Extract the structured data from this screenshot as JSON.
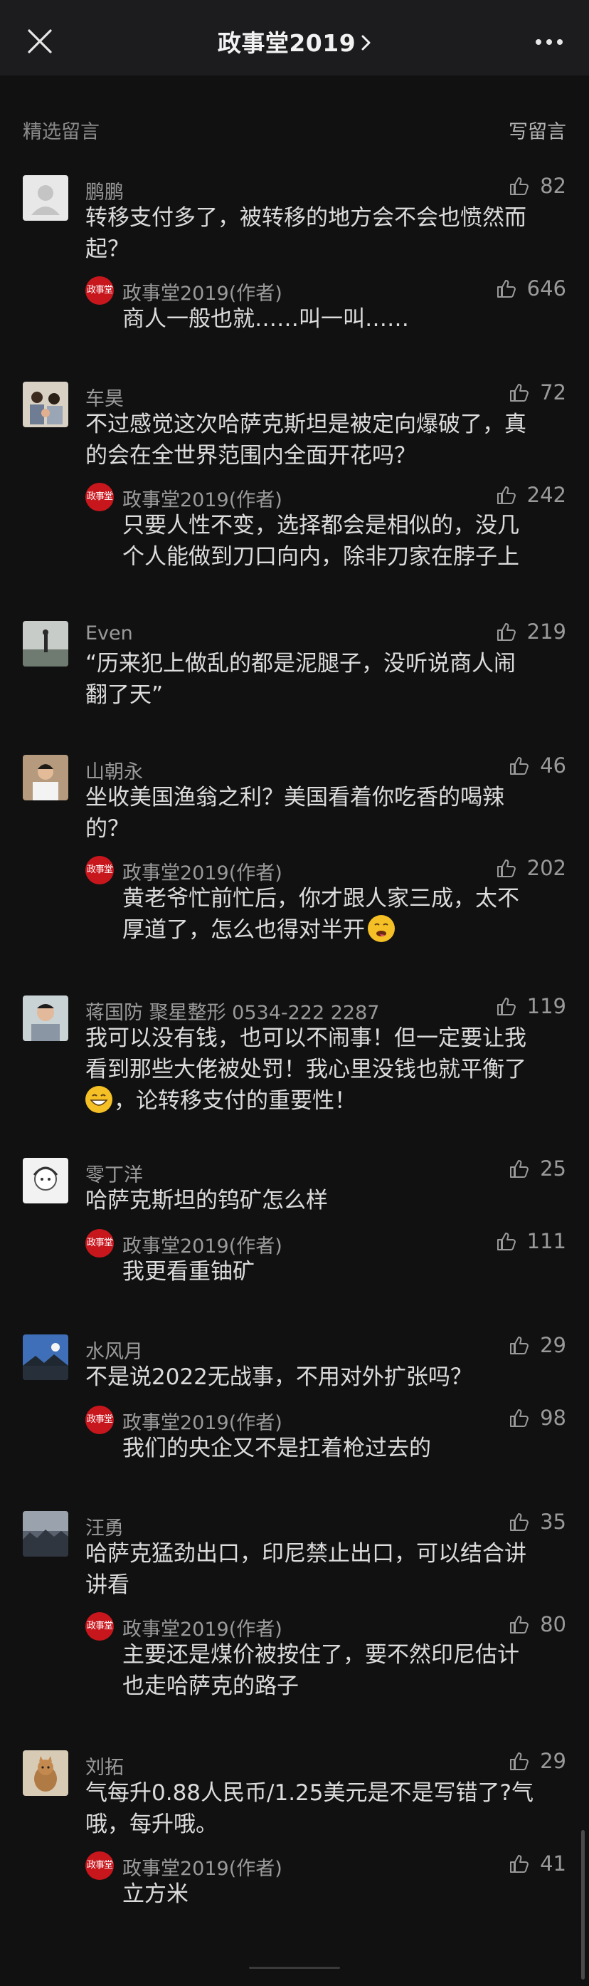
{
  "header": {
    "title": "政事堂2019",
    "chevron": "›"
  },
  "section": {
    "title": "精选留言",
    "write_label": "写留言"
  },
  "author_badge_text": "政事堂",
  "comments": [
    {
      "nick": "鹏鹏",
      "likes": "82",
      "lines": [
        "转移支付多了，被转移的地方会不会也愤然而",
        "起？"
      ],
      "reply": {
        "nick": "政事堂2019(作者)",
        "likes": "646",
        "lines": [
          "商人一般也就……叫一叫……"
        ]
      }
    },
    {
      "nick": "车昊",
      "likes": "72",
      "lines": [
        "不过感觉这次哈萨克斯坦是被定向爆破了，真",
        "的会在全世界范围内全面开花吗？"
      ],
      "reply": {
        "nick": "政事堂2019(作者)",
        "likes": "242",
        "lines": [
          "只要人性不变，选择都会是相似的，没几",
          "个人能做到刀口向内，除非刀家在脖子上"
        ]
      }
    },
    {
      "nick": "Even",
      "likes": "219",
      "lines": [
        "“历来犯上做乱的都是泥腿子，没听说商人闹",
        "翻了天”"
      ]
    },
    {
      "nick": "山朝永",
      "likes": "46",
      "lines": [
        "坐收美国渔翁之利？美国看着你吃香的喝辣",
        "的？"
      ],
      "reply": {
        "nick": "政事堂2019(作者)",
        "likes": "202",
        "lines": [
          "黄老爷忙前忙后，你才跟人家三成，太不",
          "厚道了，怎么也得对半开"
        ]
      }
    },
    {
      "nick": "蒋国防 聚星整形 0534-222 2287",
      "likes": "119",
      "lines": [
        "我可以没有钱，也可以不闹事！但一定要让我",
        "看到那些大佬被处罚！我心里没钱也就平衡了",
        "，论转移支付的重要性！"
      ]
    },
    {
      "nick": "零丁洋",
      "likes": "25",
      "lines": [
        "哈萨克斯坦的钨矿怎么样"
      ],
      "reply": {
        "nick": "政事堂2019(作者)",
        "likes": "111",
        "lines": [
          "我更看重铀矿"
        ]
      }
    },
    {
      "nick": "水风月",
      "likes": "29",
      "lines": [
        "不是说2022无战事，不用对外扩张吗？"
      ],
      "reply": {
        "nick": "政事堂2019(作者)",
        "likes": "98",
        "lines": [
          "我们的央企又不是扛着枪过去的"
        ]
      }
    },
    {
      "nick": "汪勇",
      "likes": "35",
      "lines": [
        "哈萨克猛劲出口，印尼禁止出口，可以结合讲",
        "讲看"
      ],
      "reply": {
        "nick": "政事堂2019(作者)",
        "likes": "80",
        "lines": [
          "主要还是煤价被按住了，要不然印尼估计",
          "也走哈萨克的路子"
        ]
      }
    },
    {
      "nick": "刘拓",
      "likes": "29",
      "lines": [
        "气每升0.88人民币/1.25美元是不是写错了?气",
        "哦，每升哦。"
      ],
      "reply": {
        "nick": "政事堂2019(作者)",
        "likes": "41",
        "lines": [
          "立方米"
        ]
      }
    }
  ]
}
